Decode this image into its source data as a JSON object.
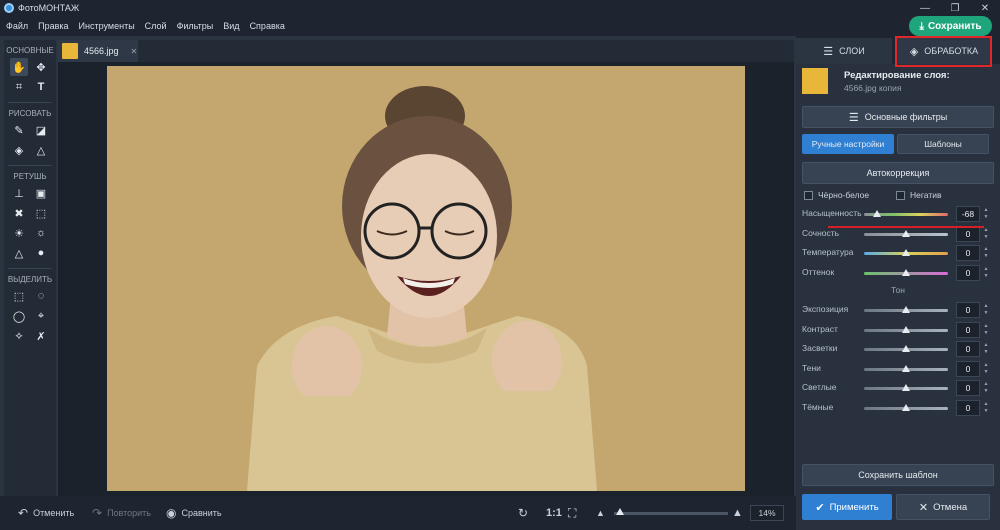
{
  "window": {
    "title": "ФотоМОНТАЖ"
  },
  "menu": [
    "Файл",
    "Правка",
    "Инструменты",
    "Слой",
    "Фильтры",
    "Вид",
    "Справка"
  ],
  "save_button": "Сохранить",
  "tools": {
    "sections": [
      "ОСНОВНЫЕ",
      "РИСОВАТЬ",
      "РЕТУШЬ",
      "ВЫДЕЛИТЬ"
    ]
  },
  "file_tab": {
    "name": "4566.jpg",
    "close": "✕"
  },
  "panel": {
    "tab_layers": "СЛОИ",
    "tab_processing": "ОБРАБОТКА",
    "layer_title": "Редактирование слоя:",
    "layer_sub": "4566.jpg копия",
    "basic_filters": "Основные фильтры",
    "sub_manual": "Ручные настройки",
    "sub_templates": "Шаблоны",
    "autocorrect": "Автокоррекция",
    "bw": "Чёрно-белое",
    "negative": "Негатив",
    "tone_header": "Тон",
    "save_template": "Сохранить шаблон",
    "apply": "Применить",
    "cancel": "Отмена"
  },
  "sliders": [
    {
      "label": "Насыщенность",
      "value": "-68",
      "level": 0.16
    },
    {
      "label": "Сочность",
      "value": "0",
      "level": 0.5
    },
    {
      "label": "Температура",
      "value": "0",
      "level": 0.5
    },
    {
      "label": "Оттенок",
      "value": "0",
      "level": 0.5
    }
  ],
  "tone_sliders": [
    {
      "label": "Экспозиция",
      "value": "0",
      "level": 0.5
    },
    {
      "label": "Контраст",
      "value": "0",
      "level": 0.5
    },
    {
      "label": "Засветки",
      "value": "0",
      "level": 0.5
    },
    {
      "label": "Тени",
      "value": "0",
      "level": 0.5
    },
    {
      "label": "Светлые",
      "value": "0",
      "level": 0.5
    },
    {
      "label": "Тёмные",
      "value": "0",
      "level": 0.5
    }
  ],
  "bottom": {
    "undo": "Отменить",
    "redo": "Повторить",
    "compare": "Сравнить",
    "ratio": "1:1",
    "zoom": "14%",
    "zoom_level": 0.05
  },
  "colors": {
    "accent": "#1fa57c",
    "apply": "#2f7fd3",
    "highlight": "#e0272a"
  }
}
